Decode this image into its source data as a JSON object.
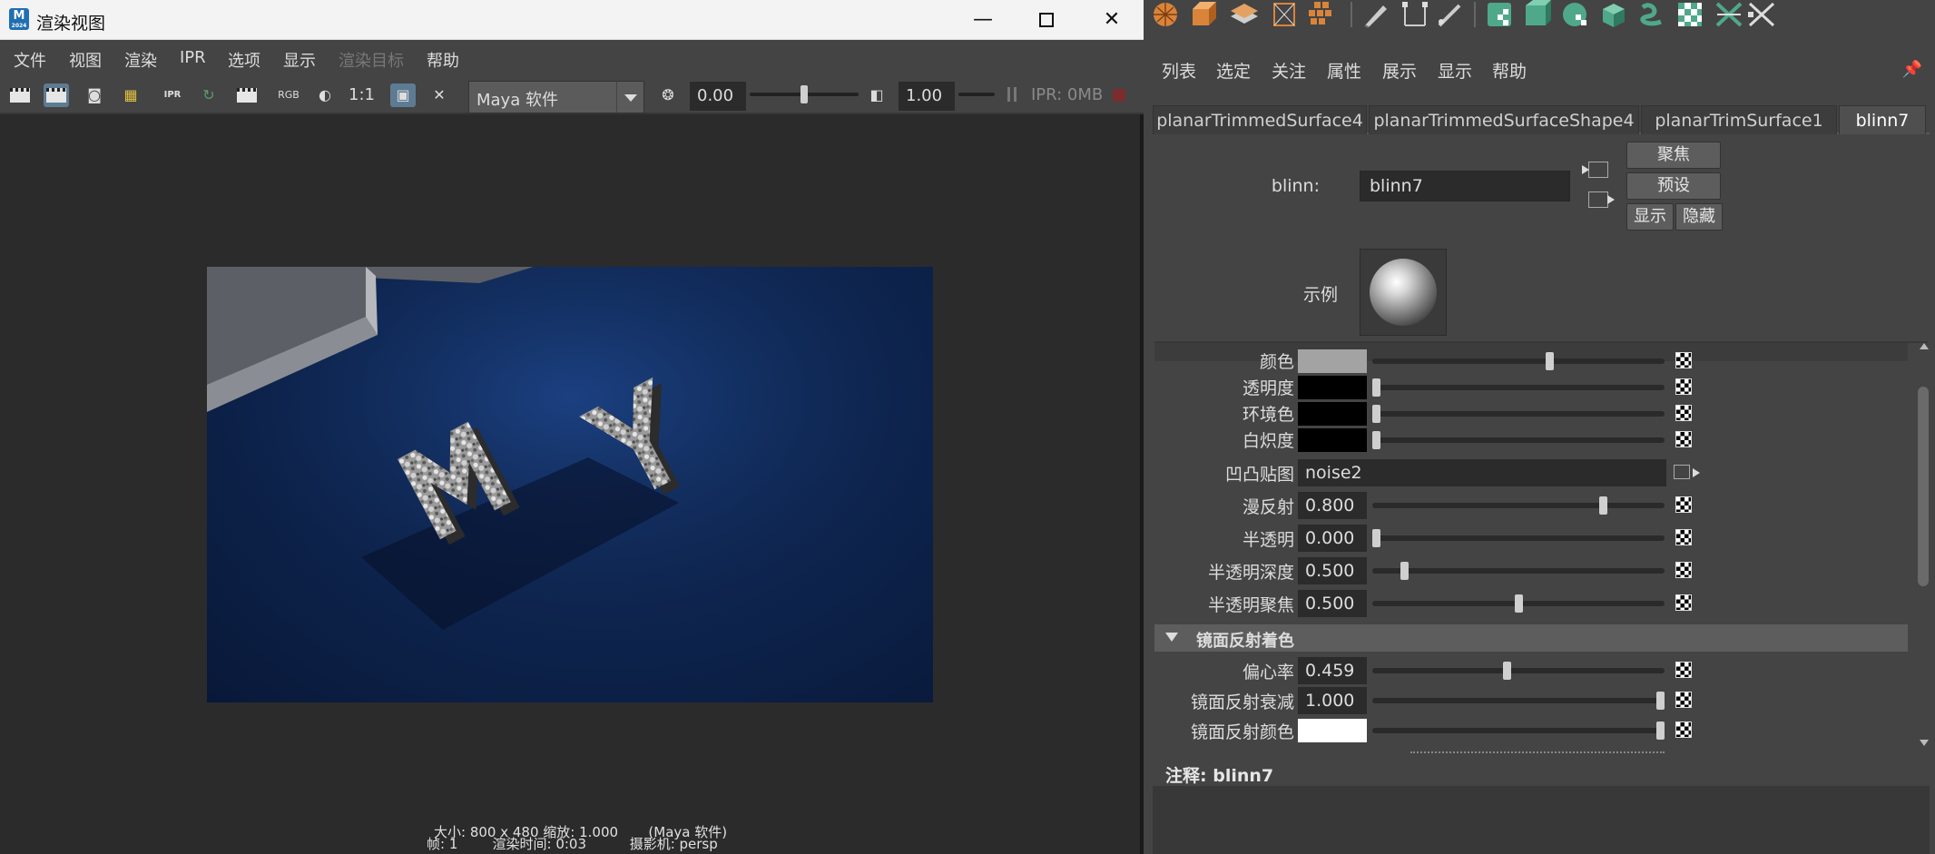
{
  "render_view": {
    "title": "渲染视图",
    "app_icon": {
      "letter": "M",
      "sub": "2024"
    },
    "window_controls": {
      "minimize": "—",
      "maximize": "square",
      "close": "✕"
    },
    "menu": [
      "文件",
      "视图",
      "渲染",
      "IPR",
      "选项",
      "显示",
      "渲染目标",
      "帮助"
    ],
    "toolbar": {
      "rgb_label": "RGB",
      "ratio_label": "1:1",
      "renderer": "Maya 软件",
      "exposure": "0.00",
      "gamma": "1.00",
      "ipr_memory": "IPR: 0MB"
    },
    "caption_line1": "大小: 800 x 480 缩放: 1.000       (Maya 软件)",
    "caption_line2": "帧: 1        渲染时间: 0:03          摄影机: persp"
  },
  "attribute_editor": {
    "menu": [
      "列表",
      "选定",
      "关注",
      "属性",
      "展示",
      "显示",
      "帮助"
    ],
    "tabs": [
      "planarTrimmedSurface4",
      "planarTrimmedSurfaceShape4",
      "planarTrimSurface1",
      "blinn7"
    ],
    "active_tab": "blinn7",
    "node_type_label": "blinn:",
    "node_name": "blinn7",
    "buttons": {
      "focus": "聚焦",
      "presets": "预设",
      "show": "显示",
      "hide": "隐藏"
    },
    "sample_label": "示例",
    "common_attrs": [
      {
        "label": "颜色",
        "kind": "color",
        "swatch": "#a3a3a3",
        "level": 0.61
      },
      {
        "label": "透明度",
        "kind": "color",
        "swatch": "#000000",
        "level": 0.0
      },
      {
        "label": "环境色",
        "kind": "color",
        "swatch": "#000000",
        "level": 0.0
      },
      {
        "label": "白炽度",
        "kind": "color",
        "swatch": "#000000",
        "level": 0.0
      }
    ],
    "bump_map": {
      "label": "凹凸贴图",
      "value": "noise2"
    },
    "numeric_attrs": [
      {
        "label": "漫反射",
        "value": "0.800",
        "level": 0.8
      },
      {
        "label": "半透明",
        "value": "0.000",
        "level": 0.0
      },
      {
        "label": "半透明深度",
        "value": "0.500",
        "level": 0.1
      },
      {
        "label": "半透明聚焦",
        "value": "0.500",
        "level": 0.5
      }
    ],
    "specular_section_title": "镜面反射着色",
    "specular_attrs": [
      {
        "label": "偏心率",
        "kind": "number",
        "value": "0.459",
        "level": 0.459
      },
      {
        "label": "镜面反射衰减",
        "kind": "number",
        "value": "1.000",
        "level": 1.0
      },
      {
        "label": "镜面反射颜色",
        "kind": "color",
        "swatch": "#ffffff",
        "level": 1.0
      }
    ],
    "notes_label": "注释:",
    "notes_node": "blinn7"
  }
}
